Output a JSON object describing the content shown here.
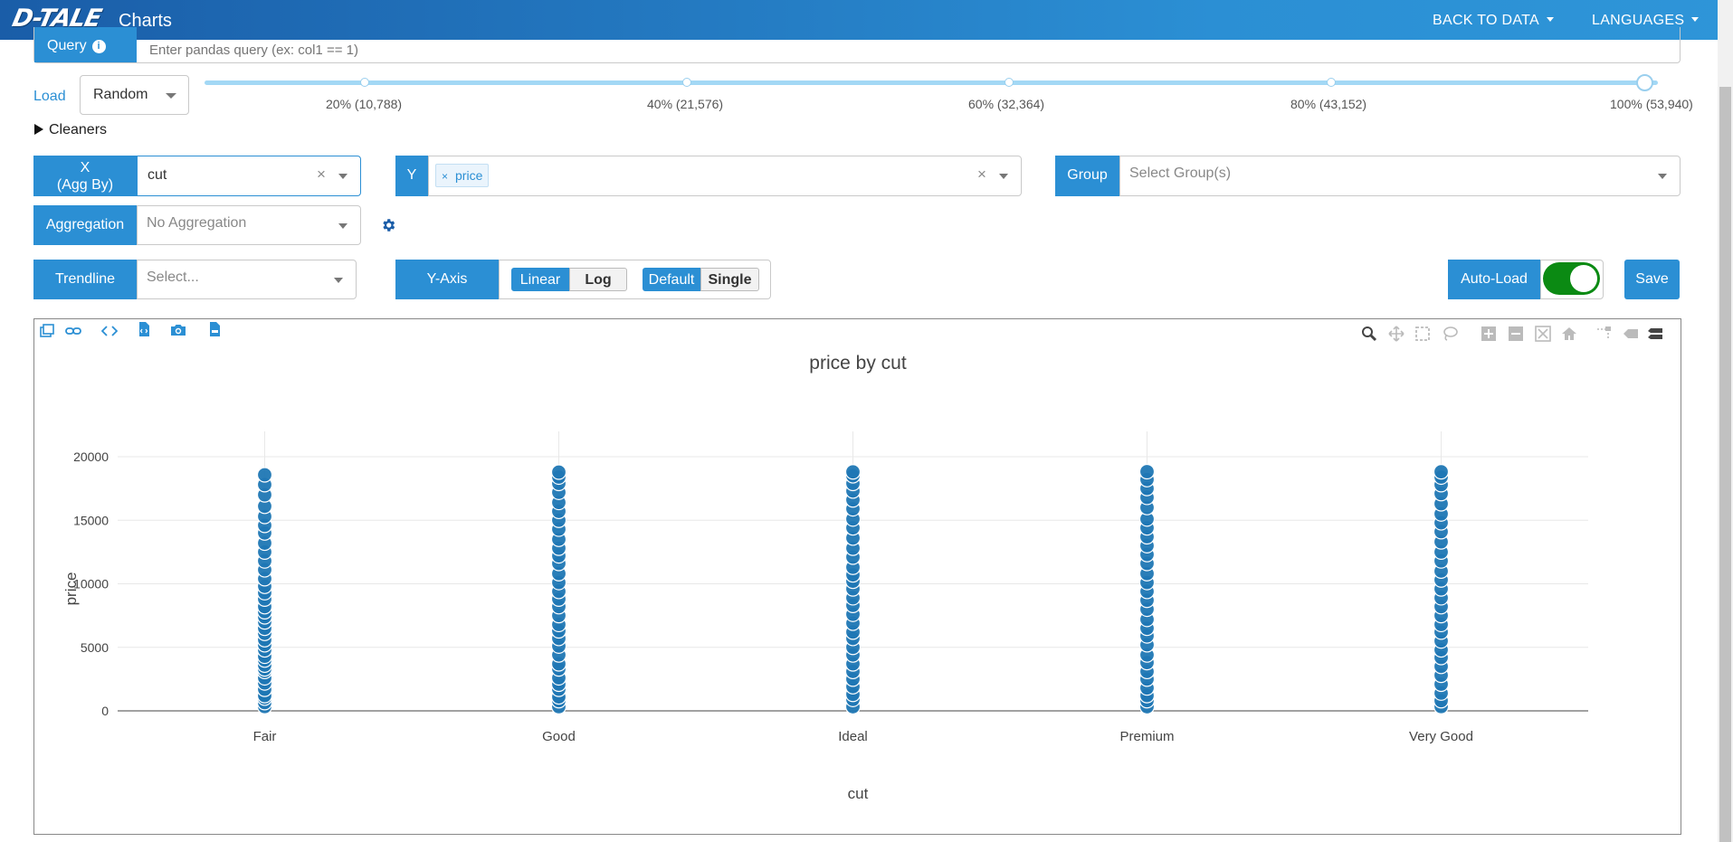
{
  "header": {
    "logo": "D-TALE",
    "title": "Charts",
    "back_to_data": "BACK TO DATA",
    "languages": "LANGUAGES"
  },
  "query": {
    "label": "Query",
    "info_icon": "info-icon",
    "placeholder": "Enter pandas query (ex: col1 == 1)"
  },
  "load": {
    "label": "Load",
    "selected": "Random",
    "slider_value_pct": 100,
    "marks": [
      "20% (10,788)",
      "40% (21,576)",
      "60% (32,364)",
      "80% (43,152)",
      "100% (53,940)"
    ]
  },
  "cleaners": {
    "label": "Cleaners"
  },
  "x_axis": {
    "label_line1": "X",
    "label_line2": "(Agg By)",
    "value": "cut"
  },
  "y_axis": {
    "label": "Y",
    "tags": [
      "price"
    ]
  },
  "group": {
    "label": "Group",
    "placeholder": "Select Group(s)"
  },
  "aggregation": {
    "label": "Aggregation",
    "placeholder": "No Aggregation"
  },
  "trendline": {
    "label": "Trendline",
    "placeholder": "Select..."
  },
  "y_axis_type": {
    "label": "Y-Axis",
    "scale_options": [
      "Linear",
      "Log"
    ],
    "scale_selected": "Linear",
    "mode_options": [
      "Default",
      "Single"
    ],
    "mode_selected": "Default"
  },
  "auto_load": {
    "label": "Auto-Load",
    "enabled": true
  },
  "save": {
    "label": "Save"
  },
  "toolbar_left": [
    "popup-icon",
    "link-icon",
    "code-icon",
    "code-export-icon",
    "camera-icon",
    "csv-export-icon"
  ],
  "toolbar_right": [
    "zoom-icon",
    "pan-icon",
    "box-select-icon",
    "lasso-select-icon",
    "zoom-in-icon",
    "zoom-out-icon",
    "autoscale-icon",
    "reset-axes-icon",
    "spike-lines-icon",
    "hover-closest-icon",
    "hover-compare-icon"
  ],
  "colors": {
    "accent": "#2b8fd4",
    "marker": "#1f77b4",
    "toggle_on": "#0b8a13"
  },
  "chart_data": {
    "type": "scatter",
    "title": "price by cut",
    "xlabel": "cut",
    "ylabel": "price",
    "categories": [
      "Fair",
      "Good",
      "Ideal",
      "Premium",
      "Very Good"
    ],
    "ylim": [
      0,
      20000
    ],
    "yticks": [
      "0",
      "5000",
      "10000",
      "15000",
      "20000"
    ],
    "grid": true,
    "series": [
      {
        "values": [
          [
            337,
            650,
            1000,
            1200,
            1700,
            2200,
            2600,
            3100,
            3300,
            3600,
            4000,
            4300,
            4800,
            5200,
            5600,
            6100,
            6500,
            7000,
            7400,
            7800,
            8200,
            8800,
            9300,
            9800,
            10400,
            11100,
            11800,
            12500,
            13200,
            14000,
            14600,
            15300,
            16100,
            17000,
            17800,
            18574
          ],
          [
            327,
            800,
            1100,
            1700,
            2100,
            2600,
            3300,
            3700,
            4400,
            5100,
            5700,
            6300,
            6800,
            7500,
            8200,
            8800,
            9400,
            10100,
            10800,
            11600,
            12200,
            12800,
            13500,
            14300,
            15000,
            15700,
            16400,
            17200,
            17900,
            18400,
            18788
          ],
          [
            326,
            900,
            1300,
            1900,
            2500,
            3100,
            3700,
            4400,
            5000,
            5700,
            6200,
            6900,
            7600,
            8300,
            8900,
            9600,
            10200,
            10700,
            11300,
            12100,
            12800,
            13600,
            14400,
            15100,
            15900,
            16600,
            17300,
            17900,
            18500,
            18806
          ],
          [
            326,
            800,
            1200,
            1800,
            2500,
            3100,
            3800,
            4400,
            5200,
            5900,
            6500,
            7200,
            8000,
            8700,
            9400,
            10100,
            10800,
            11600,
            12300,
            13000,
            13700,
            14400,
            15100,
            16000,
            16800,
            17500,
            18200,
            18823
          ],
          [
            336,
            800,
            1400,
            2100,
            2800,
            3500,
            4200,
            4800,
            5500,
            6200,
            6800,
            7500,
            8200,
            8900,
            9600,
            10300,
            11000,
            11800,
            12500,
            13300,
            14100,
            14800,
            15500,
            16300,
            17100,
            17800,
            18400,
            18818
          ]
        ]
      }
    ]
  }
}
